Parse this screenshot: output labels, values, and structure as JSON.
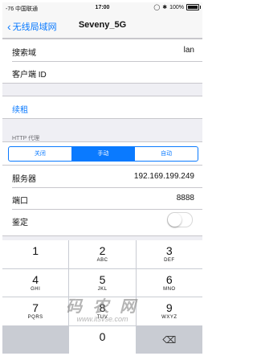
{
  "status_bar": {
    "carrier": "-76 中国联通",
    "time": "17:00",
    "battery": "100%"
  },
  "nav": {
    "back_label": "无线局域网",
    "title": "Seveny_5G"
  },
  "fields": {
    "search_domain_label": "搜索域",
    "search_domain_value": "lan",
    "client_id_label": "客户端 ID"
  },
  "renew_label": "续租",
  "proxy": {
    "header": "HTTP 代理",
    "segments": [
      "关闭",
      "手动",
      "自动"
    ],
    "selected": "手动",
    "server_label": "服务器",
    "server_value": "192.169.199.249",
    "port_label": "端口",
    "port_value": "8888",
    "auth_label": "鉴定",
    "auth_on": false
  },
  "keypad": [
    {
      "digit": "1",
      "letters": ""
    },
    {
      "digit": "2",
      "letters": "ABC"
    },
    {
      "digit": "3",
      "letters": "DEF"
    },
    {
      "digit": "4",
      "letters": "GHI"
    },
    {
      "digit": "5",
      "letters": "JKL"
    },
    {
      "digit": "6",
      "letters": "MNO"
    },
    {
      "digit": "7",
      "letters": "PQRS"
    },
    {
      "digit": "8",
      "letters": "TUV"
    },
    {
      "digit": "9",
      "letters": "WXYZ"
    },
    {
      "digit": "0",
      "letters": ""
    }
  ],
  "watermark": {
    "text": "码 农 网",
    "url": "www.itsvse.com"
  },
  "colors": {
    "accent": "#0a7aff",
    "group_bg": "#efeff4",
    "keypad_bg": "#c9ccd3"
  }
}
